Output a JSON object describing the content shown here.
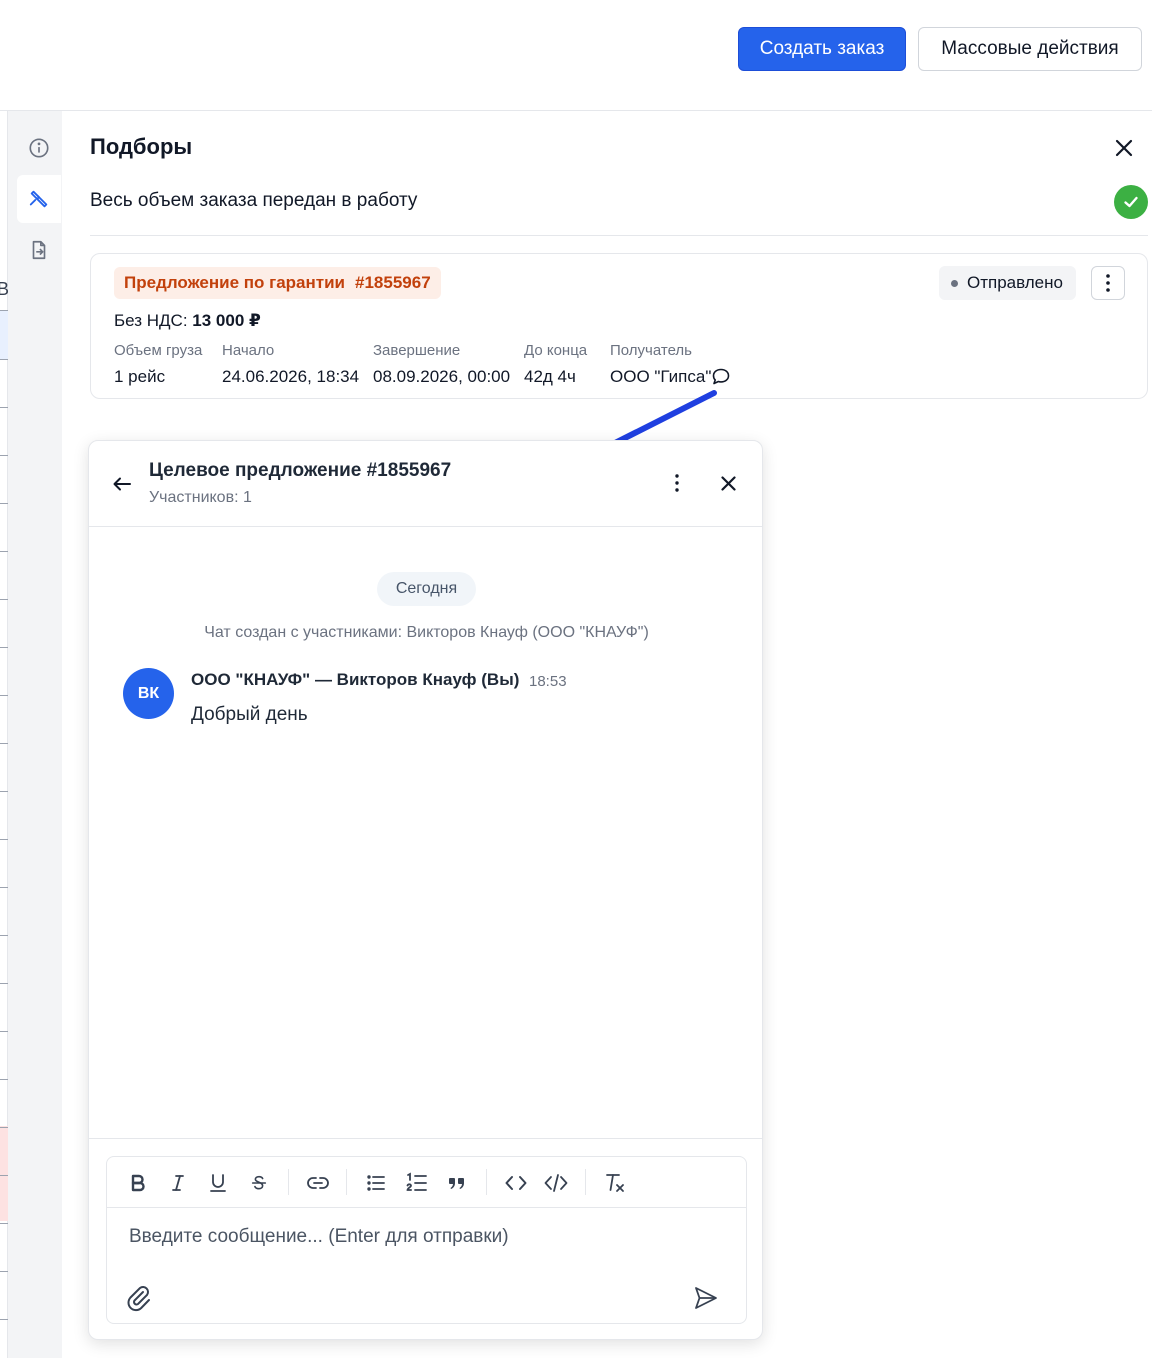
{
  "topbar": {
    "create_order": "Создать заказ",
    "bulk_actions": "Массовые действия"
  },
  "left_strip": {
    "cut_text": "В"
  },
  "rail": {
    "items": [
      {
        "icon": "info-icon",
        "active": false
      },
      {
        "icon": "hammer-icon",
        "active": true
      },
      {
        "icon": "document-export-icon",
        "active": false
      }
    ]
  },
  "panel": {
    "title": "Подборы",
    "status": "Весь объем заказа передан в работу",
    "status_color": "#3cb043"
  },
  "offer": {
    "tag_label": "Предложение по гарантии",
    "tag_number": "#1855967",
    "price_label": "Без НДС:",
    "price_value": "13 000 ₽",
    "columns": [
      {
        "label": "Объем груза",
        "value": "1 рейс"
      },
      {
        "label": "Начало",
        "value": "24.06.2026, 18:34"
      },
      {
        "label": "Завершение",
        "value": "08.09.2026, 00:00"
      },
      {
        "label": "До конца",
        "value": "42д 4ч"
      },
      {
        "label": "Получатель",
        "value": "ООО \"Гипса\""
      }
    ],
    "status_badge": "Отправлено"
  },
  "chat": {
    "title": "Целевое предложение #1855967",
    "participants": "Участников: 1",
    "day": "Сегодня",
    "system_message": "Чат создан с участниками: Викторов Кнауф (ООО \"КНАУФ\")",
    "messages": [
      {
        "avatar": "ВК",
        "author": "ООО \"КНАУФ\" — Викторов Кнауф (Вы)",
        "time": "18:53",
        "text": "Добрый день"
      }
    ],
    "composer": {
      "placeholder": "Введите сообщение... (Enter для отправки)"
    }
  },
  "colors": {
    "primary": "#2563eb",
    "annotation_arrow": "#1f3fe0",
    "tag_text": "#c2410c",
    "tag_bg": "#fdeee7"
  }
}
